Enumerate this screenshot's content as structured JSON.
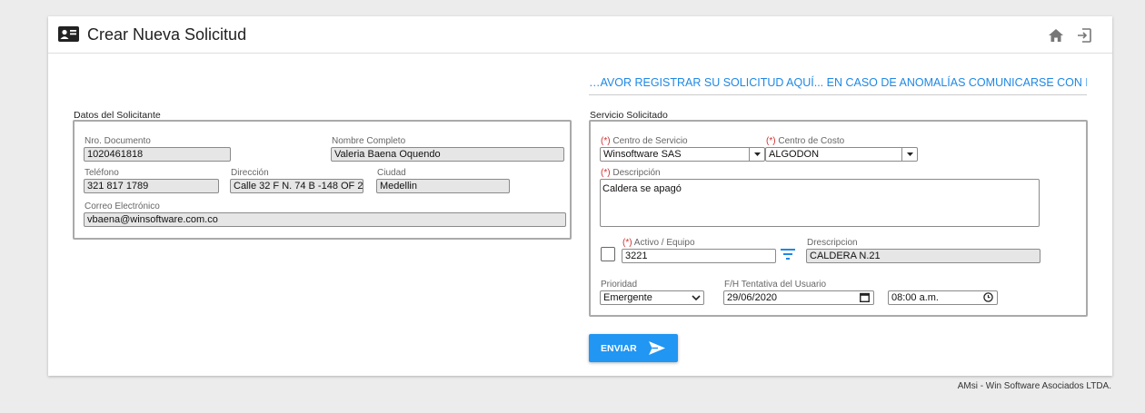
{
  "header": {
    "title": "Crear Nueva Solicitud",
    "icons": [
      "contact-card-icon",
      "home-icon",
      "exit-icon"
    ]
  },
  "notice": "…AVOR REGISTRAR SU SOLICITUD AQUÍ... EN CASO DE ANOMALÍAS COMUNICARSE CON EL ADMIN",
  "solicitante": {
    "section_label": "Datos del Solicitante",
    "documento": {
      "label": "Nro. Documento",
      "value": "1020461818"
    },
    "nombre": {
      "label": "Nombre Completo",
      "value": "Valeria Baena Oquendo"
    },
    "telefono": {
      "label": "Teléfono",
      "value": "321 817 1789"
    },
    "direccion": {
      "label": "Dirección",
      "value": "Calle 32 F N. 74 B -148 OF 2"
    },
    "ciudad": {
      "label": "Ciudad",
      "value": "Medellin"
    },
    "correo": {
      "label": "Correo Electrónico",
      "value": "vbaena@winsoftware.com.co"
    }
  },
  "servicio": {
    "section_label": "Servicio Solicitado",
    "required_mark": "(*)",
    "centro_servicio": {
      "label": "Centro de Servicio",
      "value": "Winsoftware SAS"
    },
    "centro_costo": {
      "label": "Centro de Costo",
      "value": "ALGODON"
    },
    "descripcion": {
      "label": "Descripción",
      "value": "Caldera se apagó"
    },
    "activo": {
      "label": "Activo / Equipo",
      "value": "3221",
      "checked": false
    },
    "descripcion_activo": {
      "label": "Drescripcion",
      "value": "CALDERA N.21"
    },
    "prioridad": {
      "label": "Prioridad",
      "value": "Emergente"
    },
    "fecha_tentativa": {
      "label": "F/H Tentativa del Usuario",
      "date": "29/06/2020",
      "time": "08:00 a.m."
    }
  },
  "send_button": {
    "label": "ENVIAR"
  },
  "footer": "AMsi - Win Software Asociados LTDA.",
  "colors": {
    "accent": "#2196f3",
    "notice": "#1e88e5",
    "required": "#d32f2f"
  }
}
